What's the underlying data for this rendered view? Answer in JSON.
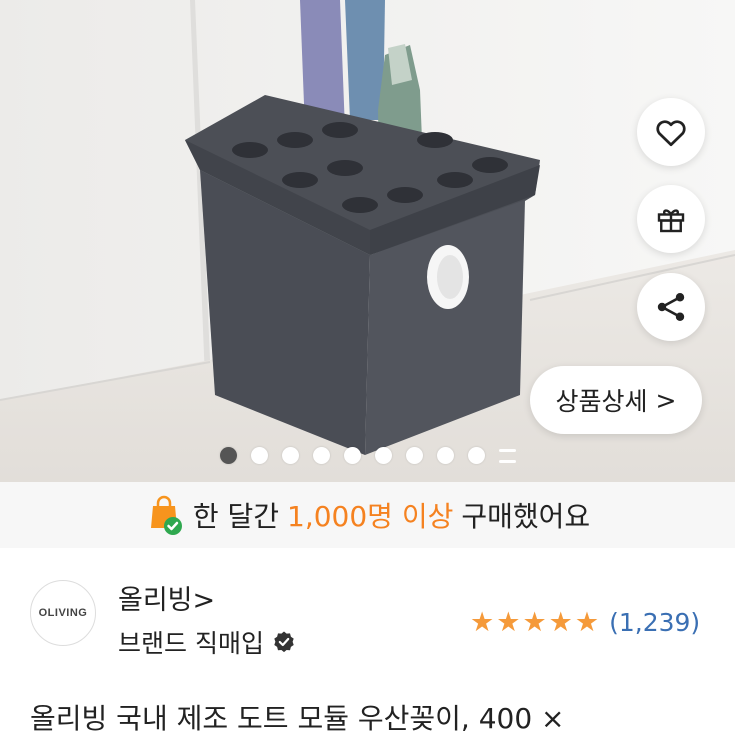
{
  "product_image": {
    "pagination": {
      "total": 10,
      "active_index": 0
    }
  },
  "actions": {
    "wishlist_icon": "heart-icon",
    "gift_icon": "gift-icon",
    "share_icon": "share-icon",
    "detail_label": "상품상세",
    "detail_chevron": ">"
  },
  "banner": {
    "prefix": "한 달간",
    "count": "1,000명 이상",
    "suffix": "구매했어요",
    "accent_color": "#f58220"
  },
  "brand": {
    "logo_text": "OLIVING",
    "name": "올리빙>",
    "subtitle": "브랜드 직매입"
  },
  "rating": {
    "stars": 5,
    "review_count": "(1,239)",
    "star_color": "#f59a3a"
  },
  "product": {
    "title": "올리빙 국내 제조 도트 모듈 우산꽂이, 400 ×"
  }
}
